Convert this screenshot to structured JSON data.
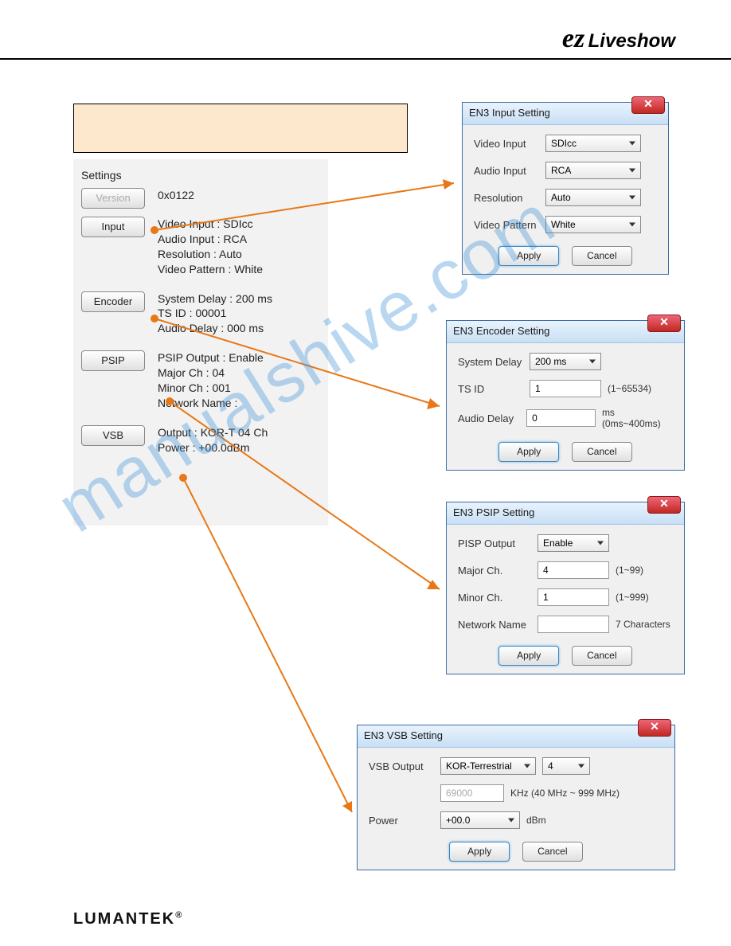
{
  "header": {
    "logo_ez": "ez",
    "logo_liveshow": "Liveshow"
  },
  "settings": {
    "title": "Settings",
    "version_btn": "Version",
    "version_val": "0x0122",
    "input_btn": "Input",
    "input_val": "Video Input : SDIcc\nAudio Input : RCA\nResolution  : Auto\nVideo Pattern : White",
    "encoder_btn": "Encoder",
    "encoder_val": "System Delay : 200 ms\nTS ID : 00001\nAudio Delay : 000 ms",
    "psip_btn": "PSIP",
    "psip_val": "PSIP Output : Enable\nMajor Ch : 04\nMinor Ch : 001\nNetwork Name :",
    "vsb_btn": "VSB",
    "vsb_val": "Output : KOR-T 04 Ch\nPower : +00.0dBm"
  },
  "dlg_input": {
    "title": "EN3 Input Setting",
    "r1l": "Video Input",
    "r1v": "SDIcc",
    "r2l": "Audio Input",
    "r2v": "RCA",
    "r3l": "Resolution",
    "r3v": "Auto",
    "r4l": "Video Pattern",
    "r4v": "White",
    "apply": "Apply",
    "cancel": "Cancel"
  },
  "dlg_encoder": {
    "title": "EN3 Encoder Setting",
    "r1l": "System Delay",
    "r1v": "200 ms",
    "r2l": "TS ID",
    "r2v": "1",
    "r2h": "(1~65534)",
    "r3l": "Audio Delay",
    "r3v": "0",
    "r3h": "ms (0ms~400ms)",
    "apply": "Apply",
    "cancel": "Cancel"
  },
  "dlg_psip": {
    "title": "EN3 PSIP Setting",
    "r1l": "PISP Output",
    "r1v": "Enable",
    "r2l": "Major Ch.",
    "r2v": "4",
    "r2h": "(1~99)",
    "r3l": "Minor Ch.",
    "r3v": "1",
    "r3h": "(1~999)",
    "r4l": "Network Name",
    "r4v": "",
    "r4h": "7 Characters",
    "apply": "Apply",
    "cancel": "Cancel"
  },
  "dlg_vsb": {
    "title": "EN3 VSB Setting",
    "r1l": "VSB Output",
    "r1v1": "KOR-Terrestrial",
    "r1v2": "4",
    "r2v": "69000",
    "r2h": "KHz (40 MHz ~ 999 MHz)",
    "r3l": "Power",
    "r3v": "+00.0",
    "r3h": "dBm",
    "apply": "Apply",
    "cancel": "Cancel"
  },
  "watermark": "manualshive.com",
  "footer": "LUMANTEK"
}
